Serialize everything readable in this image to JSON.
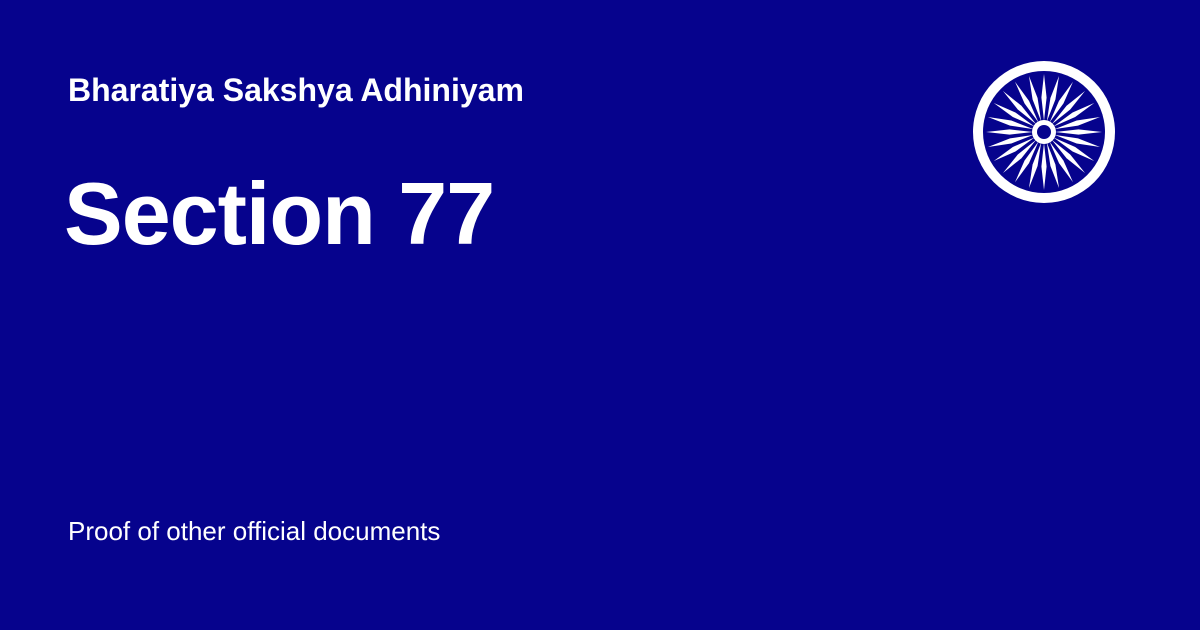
{
  "card": {
    "act_name": "Bharatiya Sakshya Adhiniyam",
    "section_title": "Section 77",
    "description": "Proof of other official documents"
  },
  "emblem": {
    "icon": "ashoka-chakra-icon",
    "spokes": 24
  },
  "colors": {
    "background": "#06038D",
    "foreground": "#FFFFFF"
  }
}
